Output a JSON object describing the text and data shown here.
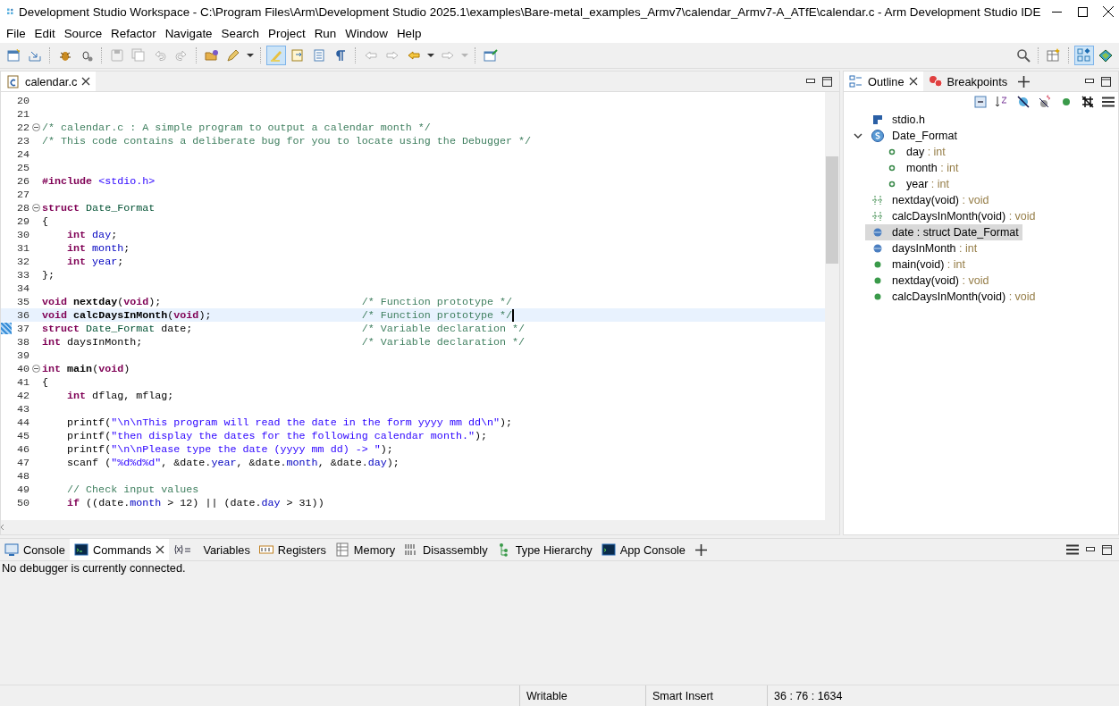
{
  "window": {
    "title": "Development Studio Workspace - C:\\Program Files\\Arm\\Development Studio 2025.1\\examples\\Bare-metal_examples_Armv7\\calendar_Armv7-A_ATfE\\calendar.c - Arm Development Studio IDE"
  },
  "menu": [
    "File",
    "Edit",
    "Source",
    "Refactor",
    "Navigate",
    "Search",
    "Project",
    "Run",
    "Window",
    "Help"
  ],
  "toolbar": [
    {
      "kind": "new-window",
      "disabled": false,
      "selected": false
    },
    {
      "kind": "import",
      "disabled": false,
      "selected": false
    },
    {
      "kind": "separator"
    },
    {
      "kind": "debug",
      "disabled": false,
      "selected": false
    },
    {
      "kind": "debug-config",
      "disabled": false,
      "selected": false
    },
    {
      "kind": "separator"
    },
    {
      "kind": "save",
      "disabled": true,
      "selected": false
    },
    {
      "kind": "save-all",
      "disabled": true,
      "selected": false
    },
    {
      "kind": "undo",
      "disabled": true,
      "selected": false
    },
    {
      "kind": "redo",
      "disabled": true,
      "selected": false
    },
    {
      "kind": "separator"
    },
    {
      "kind": "open-folder",
      "disabled": false,
      "selected": false
    },
    {
      "kind": "pen",
      "disabled": false,
      "selected": false
    },
    {
      "kind": "dropdown",
      "disabled": false,
      "selected": false
    },
    {
      "kind": "separator"
    },
    {
      "kind": "highlight",
      "disabled": false,
      "selected": true
    },
    {
      "kind": "annotation",
      "disabled": false,
      "selected": false
    },
    {
      "kind": "block",
      "disabled": false,
      "selected": false
    },
    {
      "kind": "pilcrow",
      "disabled": false,
      "selected": false
    },
    {
      "kind": "separator"
    },
    {
      "kind": "prev-edit",
      "disabled": true,
      "selected": false
    },
    {
      "kind": "next-edit",
      "disabled": true,
      "selected": false
    },
    {
      "kind": "back",
      "disabled": false,
      "selected": false
    },
    {
      "kind": "dropdown",
      "disabled": false,
      "selected": false
    },
    {
      "kind": "forward",
      "disabled": true,
      "selected": false
    },
    {
      "kind": "dropdown",
      "disabled": true,
      "selected": false
    },
    {
      "kind": "separator"
    },
    {
      "kind": "pin",
      "disabled": false,
      "selected": false
    }
  ],
  "perspective_bar": [
    {
      "kind": "search",
      "selected": false
    },
    {
      "kind": "open-perspective",
      "selected": false
    },
    {
      "kind": "development",
      "selected": true
    },
    {
      "kind": "debug-perspective",
      "selected": false
    }
  ],
  "editor": {
    "tab": {
      "label": "calendar.c",
      "selected": true
    },
    "lines": [
      {
        "n": "20"
      },
      {
        "n": "21"
      },
      {
        "n": "22",
        "fold": true,
        "tokens": [
          {
            "text": "/* calendar.c : A simple program to output a calendar month */",
            "kind": "comment"
          }
        ]
      },
      {
        "n": "23",
        "tokens": [
          {
            "text": "/* This code contains a deliberate bug for you to locate using the Debugger */",
            "kind": "comment"
          }
        ]
      },
      {
        "n": "24"
      },
      {
        "n": "25"
      },
      {
        "n": "26",
        "tokens": [
          {
            "text": "#include ",
            "kind": "keyword"
          },
          {
            "text": "<stdio.h>",
            "kind": "string"
          }
        ]
      },
      {
        "n": "27"
      },
      {
        "n": "28",
        "fold": true,
        "tokens": [
          {
            "text": "struct ",
            "kind": "keyword"
          },
          {
            "text": "Date_Format",
            "kind": "type"
          }
        ]
      },
      {
        "n": "29",
        "tokens": [
          {
            "text": "{",
            "kind": "plain"
          }
        ]
      },
      {
        "n": "30",
        "tokens": [
          {
            "text": "    int ",
            "kind": "keyword"
          },
          {
            "text": "day",
            "kind": "field"
          },
          {
            "text": ";",
            "kind": "plain"
          }
        ]
      },
      {
        "n": "31",
        "tokens": [
          {
            "text": "    int ",
            "kind": "keyword"
          },
          {
            "text": "month",
            "kind": "field"
          },
          {
            "text": ";",
            "kind": "plain"
          }
        ]
      },
      {
        "n": "32",
        "tokens": [
          {
            "text": "    int ",
            "kind": "keyword"
          },
          {
            "text": "year",
            "kind": "field"
          },
          {
            "text": ";",
            "kind": "plain"
          }
        ]
      },
      {
        "n": "33",
        "tokens": [
          {
            "text": "};",
            "kind": "plain"
          }
        ]
      },
      {
        "n": "34"
      },
      {
        "n": "35",
        "tokens": [
          {
            "text": "void ",
            "kind": "keyword"
          },
          {
            "text": "nextday",
            "kind": "function"
          },
          {
            "text": "(",
            "kind": "plain"
          },
          {
            "text": "void",
            "kind": "keyword"
          },
          {
            "text": ");",
            "kind": "plain"
          }
        ],
        "comment": "/* Function prototype */"
      },
      {
        "n": "36",
        "current": true,
        "tokens": [
          {
            "text": "void ",
            "kind": "keyword"
          },
          {
            "text": "calcDaysInMonth",
            "kind": "function"
          },
          {
            "text": "(",
            "kind": "plain"
          },
          {
            "text": "void",
            "kind": "keyword"
          },
          {
            "text": ");",
            "kind": "plain"
          }
        ],
        "comment": "/* Function prototype */"
      },
      {
        "n": "37",
        "marker": true,
        "tokens": [
          {
            "text": "struct ",
            "kind": "keyword"
          },
          {
            "text": "Date_Format",
            "kind": "type"
          },
          {
            "text": " date;",
            "kind": "plain"
          }
        ],
        "comment": "/* Variable declaration */"
      },
      {
        "n": "38",
        "tokens": [
          {
            "text": "int",
            "kind": "keyword"
          },
          {
            "text": " daysInMonth;",
            "kind": "plain"
          }
        ],
        "comment": "/* Variable declaration */"
      },
      {
        "n": "39"
      },
      {
        "n": "40",
        "fold": true,
        "tokens": [
          {
            "text": "int ",
            "kind": "keyword"
          },
          {
            "text": "main",
            "kind": "function"
          },
          {
            "text": "(",
            "kind": "plain"
          },
          {
            "text": "void",
            "kind": "keyword"
          },
          {
            "text": ")",
            "kind": "plain"
          }
        ]
      },
      {
        "n": "41",
        "tokens": [
          {
            "text": "{",
            "kind": "plain"
          }
        ]
      },
      {
        "n": "42",
        "tokens": [
          {
            "text": "    int",
            "kind": "keyword"
          },
          {
            "text": " dflag, mflag;",
            "kind": "plain"
          }
        ]
      },
      {
        "n": "43"
      },
      {
        "n": "44",
        "tokens": [
          {
            "text": "    printf(",
            "kind": "plain"
          },
          {
            "text": "\"\\n\\nThis program will read the date in the form yyyy mm dd\\n\"",
            "kind": "string"
          },
          {
            "text": ");",
            "kind": "plain"
          }
        ]
      },
      {
        "n": "45",
        "tokens": [
          {
            "text": "    printf(",
            "kind": "plain"
          },
          {
            "text": "\"then display the dates for the following calendar month.\"",
            "kind": "string"
          },
          {
            "text": ");",
            "kind": "plain"
          }
        ]
      },
      {
        "n": "46",
        "tokens": [
          {
            "text": "    printf(",
            "kind": "plain"
          },
          {
            "text": "\"\\n\\nPlease type the date (yyyy mm dd) -> \"",
            "kind": "string"
          },
          {
            "text": ");",
            "kind": "plain"
          }
        ]
      },
      {
        "n": "47",
        "tokens": [
          {
            "text": "    scanf (",
            "kind": "plain"
          },
          {
            "text": "\"%d%d%d\"",
            "kind": "string"
          },
          {
            "text": ", &date.",
            "kind": "plain"
          },
          {
            "text": "year",
            "kind": "field"
          },
          {
            "text": ", &date.",
            "kind": "plain"
          },
          {
            "text": "month",
            "kind": "field"
          },
          {
            "text": ", &date.",
            "kind": "plain"
          },
          {
            "text": "day",
            "kind": "field"
          },
          {
            "text": ");",
            "kind": "plain"
          }
        ]
      },
      {
        "n": "48"
      },
      {
        "n": "49",
        "tokens": [
          {
            "text": "    // Check input values",
            "kind": "comment"
          }
        ]
      },
      {
        "n": "50",
        "tokens": [
          {
            "text": "    if",
            "kind": "keyword"
          },
          {
            "text": " ((date.",
            "kind": "plain"
          },
          {
            "text": "month",
            "kind": "field"
          },
          {
            "text": " > 12) || (date.",
            "kind": "plain"
          },
          {
            "text": "day",
            "kind": "field"
          },
          {
            "text": " > 31))",
            "kind": "plain"
          }
        ]
      }
    ]
  },
  "side_tabs": [
    {
      "label": "Outline",
      "kind": "outline",
      "selected": true
    },
    {
      "label": "Breakpoints",
      "kind": "breakpoints",
      "selected": false
    }
  ],
  "outline": [
    {
      "kind": "include",
      "name": "stdio.h",
      "selected": false
    },
    {
      "kind": "struct",
      "name": "Date_Format",
      "selected": false,
      "expanded": true,
      "children": [
        {
          "kind": "field",
          "name": "day",
          "type": ": int",
          "selected": false
        },
        {
          "kind": "field",
          "name": "month",
          "type": ": int",
          "selected": false
        },
        {
          "kind": "field",
          "name": "year",
          "type": ": int",
          "selected": false
        }
      ]
    },
    {
      "kind": "prototype",
      "name": "nextday(void)",
      "type": ": void",
      "selected": false
    },
    {
      "kind": "prototype",
      "name": "calcDaysInMonth(void)",
      "type": ": void",
      "selected": false
    },
    {
      "kind": "variable",
      "name": "date : struct Date_Format",
      "selected": true
    },
    {
      "kind": "variable",
      "name": "daysInMonth",
      "type": ": int",
      "selected": false
    },
    {
      "kind": "function",
      "name": "main(void)",
      "type": ": int",
      "selected": false
    },
    {
      "kind": "function",
      "name": "nextday(void)",
      "type": ": void",
      "selected": false
    },
    {
      "kind": "function",
      "name": "calcDaysInMonth(void)",
      "type": ": void",
      "selected": false
    }
  ],
  "bottom_tabs": [
    {
      "label": "Console",
      "kind": "console",
      "selected": false
    },
    {
      "label": "Commands",
      "kind": "commands",
      "selected": true
    },
    {
      "label": "Variables",
      "kind": "variables",
      "selected": false
    },
    {
      "label": "Registers",
      "kind": "registers",
      "selected": false
    },
    {
      "label": "Memory",
      "kind": "memory",
      "selected": false
    },
    {
      "label": "Disassembly",
      "kind": "disassembly",
      "selected": false
    },
    {
      "label": "Type Hierarchy",
      "kind": "hierarchy",
      "selected": false
    },
    {
      "label": "App Console",
      "kind": "app-console",
      "selected": false
    }
  ],
  "bottom_message": "No debugger is currently connected.",
  "status_bar": [
    "Writable",
    "Smart Insert",
    "36 : 76 : 1634"
  ]
}
